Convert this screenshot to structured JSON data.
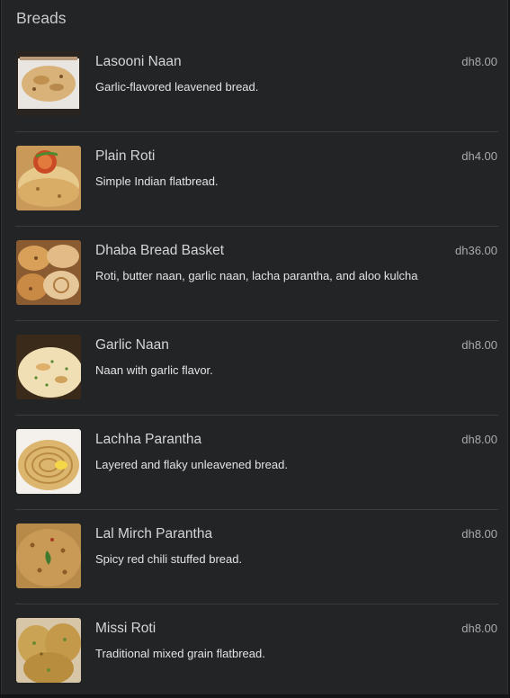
{
  "section": {
    "title": "Breads"
  },
  "items": [
    {
      "name": "Lasooni Naan",
      "description": "Garlic-flavored leavened bread.",
      "price": "dh8.00",
      "image": "lasooni-naan-photo"
    },
    {
      "name": "Plain Roti",
      "description": "Simple Indian flatbread.",
      "price": "dh4.00",
      "image": "plain-roti-photo"
    },
    {
      "name": "Dhaba Bread Basket",
      "description": "Roti, butter naan, garlic naan, lacha parantha, and aloo kulcha",
      "price": "dh36.00",
      "image": "bread-basket-photo"
    },
    {
      "name": "Garlic Naan",
      "description": "Naan with garlic flavor.",
      "price": "dh8.00",
      "image": "garlic-naan-photo"
    },
    {
      "name": "Lachha Parantha",
      "description": "Layered and flaky unleavened bread.",
      "price": "dh8.00",
      "image": "lachha-parantha-photo"
    },
    {
      "name": "Lal Mirch Parantha",
      "description": "Spicy red chili stuffed bread.",
      "price": "dh8.00",
      "image": "lal-mirch-parantha-photo"
    },
    {
      "name": "Missi Roti",
      "description": "Traditional mixed grain flatbread.",
      "price": "dh8.00",
      "image": "missi-roti-photo"
    }
  ]
}
